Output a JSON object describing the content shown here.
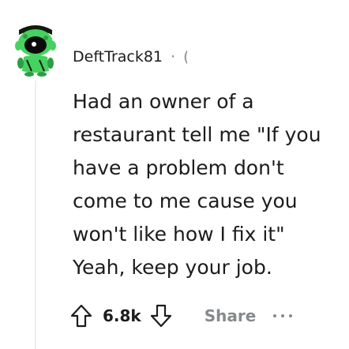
{
  "comment": {
    "author": "DeftTrack81",
    "separator": "·",
    "timestamp": "(",
    "body": "Had an owner of a\nrestaurant tell me \"If you\nhave a problem don't\ncome to me cause you\nwon't like how I fix it\"\nYeah, keep your job.",
    "score": "6.8k",
    "share_label": "Share"
  },
  "icons": {
    "avatar": "snoo-avatar",
    "upvote": "upvote-arrow-icon",
    "downvote": "downvote-arrow-icon",
    "more": "more-options-icon"
  },
  "colors": {
    "text": "#1c1c1c",
    "muted": "#878a8c",
    "thread_line": "#edeff1",
    "avatar_green": "#46d160"
  }
}
